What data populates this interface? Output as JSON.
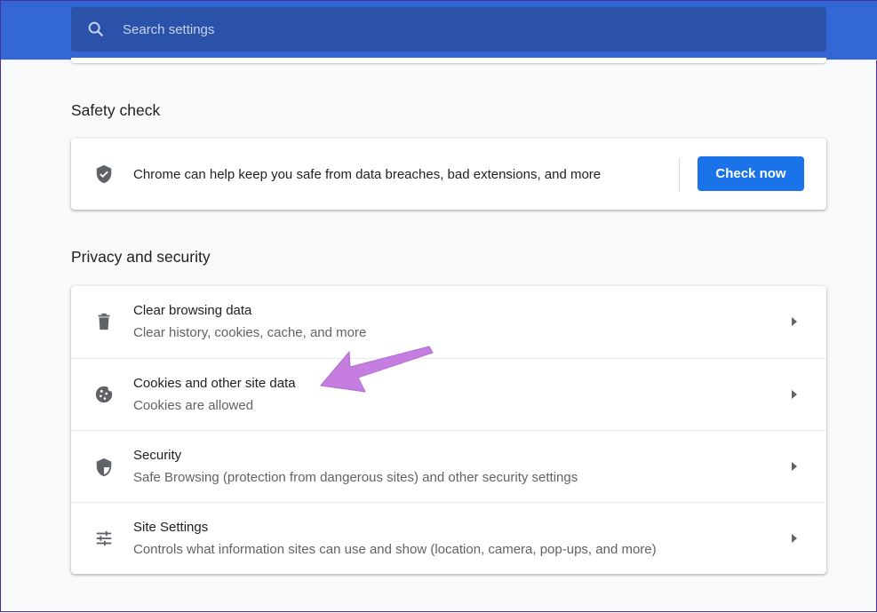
{
  "search": {
    "placeholder": "Search settings"
  },
  "safety_check": {
    "title": "Safety check",
    "description": "Chrome can help keep you safe from data breaches, bad extensions, and more",
    "button": "Check now"
  },
  "privacy": {
    "title": "Privacy and security",
    "items": [
      {
        "title": "Clear browsing data",
        "subtitle": "Clear history, cookies, cache, and more",
        "icon": "trash-icon"
      },
      {
        "title": "Cookies and other site data",
        "subtitle": "Cookies are allowed",
        "icon": "cookie-icon"
      },
      {
        "title": "Security",
        "subtitle": "Safe Browsing (protection from dangerous sites) and other security settings",
        "icon": "shield-icon"
      },
      {
        "title": "Site Settings",
        "subtitle": "Controls what information sites can use and show (location, camera, pop-ups, and more)",
        "icon": "sliders-icon"
      }
    ]
  },
  "colors": {
    "header": "#3367d6",
    "search": "#2a52a8",
    "accent": "#1a73e8",
    "annotation_arrow": "#c57ee0"
  }
}
